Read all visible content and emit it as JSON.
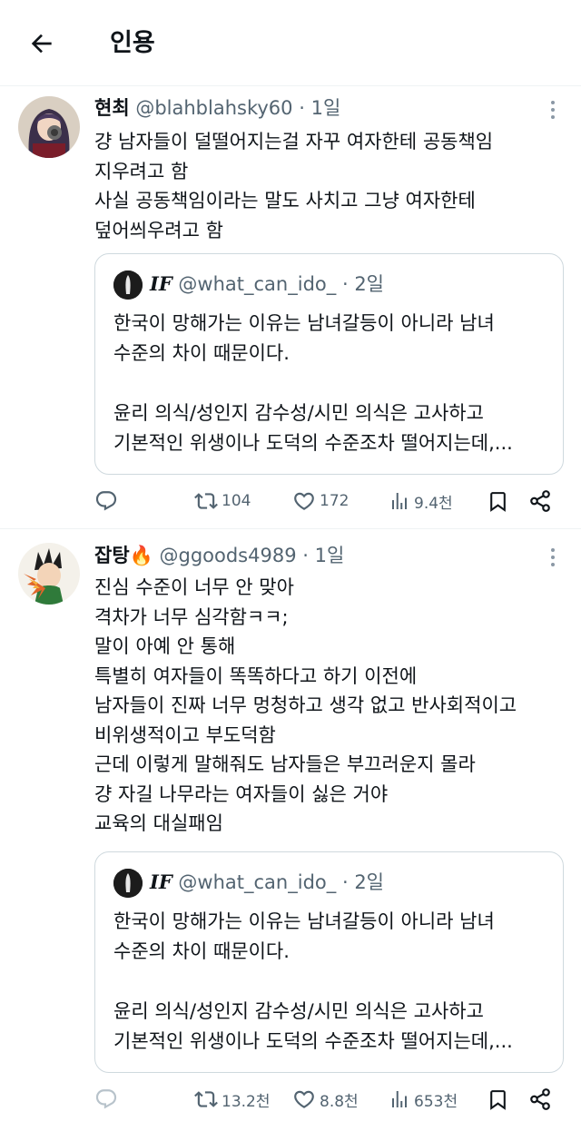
{
  "header": {
    "title": "인용"
  },
  "tweets": [
    {
      "name": "현최",
      "handle": "@blahblahsky60",
      "separator": "·",
      "time": "1일",
      "lines": [
        "걍 남자들이 덜떨어지는걸 자꾸 여자한테 공동책임",
        "지우려고 함",
        "사실 공동책임이라는 말도 사치고 그냥 여자한테",
        "덮어씌우려고 함"
      ],
      "quote": {
        "name": "IF",
        "handle": "@what_can_ido_",
        "separator": "·",
        "time": "2일",
        "lines": [
          "한국이 망해가는 이유는 남녀갈등이 아니라 남녀",
          "수준의 차이 때문이다.",
          "",
          "윤리 의식/성인지 감수성/시민 의식은 고사하고",
          "기본적인 위생이나 도덕의 수준조차 떨어지는데,..."
        ]
      },
      "stats": {
        "reposts": "104",
        "likes": "172",
        "views": "9.4천"
      }
    },
    {
      "name": "잡탕",
      "name_emoji": "🔥",
      "handle": "@ggoods4989",
      "separator": "·",
      "time": "1일",
      "lines": [
        "진심 수준이 너무 안 맞아",
        "격차가 너무 심각함ㅋㅋ;",
        "말이 아예 안 통해",
        "특별히 여자들이 똑똑하다고 하기 이전에",
        "남자들이 진짜 너무 멍청하고 생각 없고 반사회적이고",
        "비위생적이고 부도덕함",
        "근데 이렇게 말해줘도 남자들은 부끄러운지 몰라",
        "걍 자길 나무라는 여자들이 싫은 거야",
        "교육의 대실패임"
      ],
      "quote": {
        "name": "IF",
        "handle": "@what_can_ido_",
        "separator": "·",
        "time": "2일",
        "lines": [
          "한국이 망해가는 이유는 남녀갈등이 아니라 남녀",
          "수준의 차이 때문이다.",
          "",
          "윤리 의식/성인지 감수성/시민 의식은 고사하고",
          "기본적인 위생이나 도덕의 수준조차 떨어지는데,..."
        ]
      },
      "stats": {
        "reposts": "13.2천",
        "likes": "8.8천",
        "views": "653천"
      }
    }
  ],
  "colors": {
    "text": "#0f1419",
    "secondary": "#536471",
    "border": "#cfd9de",
    "divider": "#eff3f4"
  }
}
